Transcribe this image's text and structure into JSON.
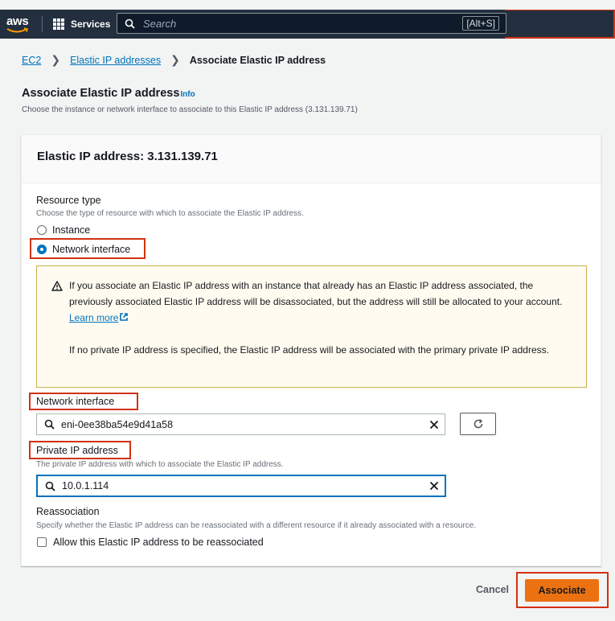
{
  "nav": {
    "logo": "aws",
    "services_label": "Services",
    "search_placeholder": "Search",
    "search_shortcut": "[Alt+S]"
  },
  "breadcrumb": {
    "items": [
      "EC2",
      "Elastic IP addresses"
    ],
    "current": "Associate Elastic IP address"
  },
  "page": {
    "title": "Associate Elastic IP address",
    "info_link": "Info",
    "description": "Choose the instance or network interface to associate to this Elastic IP address (3.131.139.71)"
  },
  "panel": {
    "header": "Elastic IP address: 3.131.139.71",
    "resource_type": {
      "label": "Resource type",
      "description": "Choose the type of resource with which to associate the Elastic IP address.",
      "options": [
        "Instance",
        "Network interface"
      ],
      "selected": "Network interface"
    },
    "alert": {
      "line1": "If you associate an Elastic IP address with an instance that already has an Elastic IP address associated, the previously associated Elastic IP address will be disassociated, but the address will still be allocated to your account.",
      "learn_more": "Learn more",
      "line2": "If no private IP address is specified, the Elastic IP address will be associated with the primary private IP address."
    },
    "network_interface": {
      "label": "Network interface",
      "value": "eni-0ee38ba54e9d41a58"
    },
    "private_ip": {
      "label": "Private IP address",
      "description": "The private IP address with which to associate the Elastic IP address.",
      "value": "10.0.1.114"
    },
    "reassociation": {
      "label": "Reassociation",
      "description": "Specify whether the Elastic IP address can be reassociated with a different resource if it already associated with a resource.",
      "checkbox_label": "Allow this Elastic IP address to be reassociated"
    }
  },
  "footer": {
    "cancel": "Cancel",
    "associate": "Associate"
  },
  "colors": {
    "nav_bg": "#232f3e",
    "primary_button": "#ec7211",
    "link": "#0073bb",
    "annotation": "#d13212"
  }
}
